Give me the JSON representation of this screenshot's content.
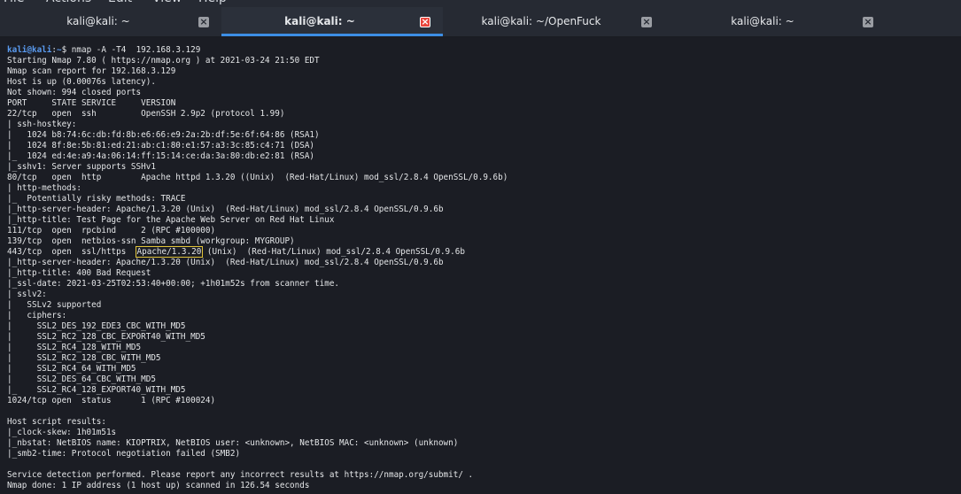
{
  "menubar": {
    "items": [
      "File",
      "Actions",
      "Edit",
      "View",
      "Help"
    ]
  },
  "tabs": [
    {
      "label": "kali@kali: ~",
      "active": false
    },
    {
      "label": "kali@kali: ~",
      "active": true
    },
    {
      "label": "kali@kali: ~/OpenFuck",
      "active": false
    },
    {
      "label": "kali@kali: ~",
      "active": false
    }
  ],
  "colors": {
    "background": "#1b1d24",
    "tabbar": "#262a33",
    "active_underline": "#3d8ee5",
    "close_active": "#e8453c",
    "prompt": "#5a9bf0",
    "highlight_box": "#e0c33a",
    "text": "#e4e6e8"
  },
  "terminal": {
    "prompt": {
      "user": "kali@kali",
      "sep": ":",
      "path": "~",
      "symbol": "$",
      "command": " nmap -A -T4  192.168.3.129"
    },
    "lines": [
      "Starting Nmap 7.80 ( https://nmap.org ) at 2021-03-24 21:50 EDT",
      "Nmap scan report for 192.168.3.129",
      "Host is up (0.00076s latency).",
      "Not shown: 994 closed ports",
      "PORT     STATE SERVICE     VERSION",
      "22/tcp   open  ssh         OpenSSH 2.9p2 (protocol 1.99)",
      "| ssh-hostkey: ",
      "|   1024 b8:74:6c:db:fd:8b:e6:66:e9:2a:2b:df:5e:6f:64:86 (RSA1)",
      "|   1024 8f:8e:5b:81:ed:21:ab:c1:80:e1:57:a3:3c:85:c4:71 (DSA)",
      "|_  1024 ed:4e:a9:4a:06:14:ff:15:14:ce:da:3a:80:db:e2:81 (RSA)",
      "|_sshv1: Server supports SSHv1",
      "80/tcp   open  http        Apache httpd 1.3.20 ((Unix)  (Red-Hat/Linux) mod_ssl/2.8.4 OpenSSL/0.9.6b)",
      "| http-methods: ",
      "|_  Potentially risky methods: TRACE",
      "|_http-server-header: Apache/1.3.20 (Unix)  (Red-Hat/Linux) mod_ssl/2.8.4 OpenSSL/0.9.6b",
      "|_http-title: Test Page for the Apache Web Server on Red Hat Linux",
      "111/tcp  open  rpcbind     2 (RPC #100000)",
      "139/tcp  open  netbios-ssn Samba smbd (workgroup: MYGROUP)",
      {
        "before": "443/tcp  open  ssl/https  ",
        "highlight": "Apache/1.3.20",
        "after": " (Unix)  (Red-Hat/Linux) mod_ssl/2.8.4 OpenSSL/0.9.6b"
      },
      "|_http-server-header: Apache/1.3.20 (Unix)  (Red-Hat/Linux) mod_ssl/2.8.4 OpenSSL/0.9.6b",
      "|_http-title: 400 Bad Request",
      "|_ssl-date: 2021-03-25T02:53:40+00:00; +1h01m52s from scanner time.",
      "| sslv2: ",
      "|   SSLv2 supported",
      "|   ciphers: ",
      "|     SSL2_DES_192_EDE3_CBC_WITH_MD5",
      "|     SSL2_RC2_128_CBC_EXPORT40_WITH_MD5",
      "|     SSL2_RC4_128_WITH_MD5",
      "|     SSL2_RC2_128_CBC_WITH_MD5",
      "|     SSL2_RC4_64_WITH_MD5",
      "|     SSL2_DES_64_CBC_WITH_MD5",
      "|_    SSL2_RC4_128_EXPORT40_WITH_MD5",
      "1024/tcp open  status      1 (RPC #100024)",
      "",
      "Host script results:",
      "|_clock-skew: 1h01m51s",
      "|_nbstat: NetBIOS name: KIOPTRIX, NetBIOS user: <unknown>, NetBIOS MAC: <unknown> (unknown)",
      "|_smb2-time: Protocol negotiation failed (SMB2)",
      "",
      "Service detection performed. Please report any incorrect results at https://nmap.org/submit/ .",
      "Nmap done: 1 IP address (1 host up) scanned in 126.54 seconds"
    ]
  }
}
